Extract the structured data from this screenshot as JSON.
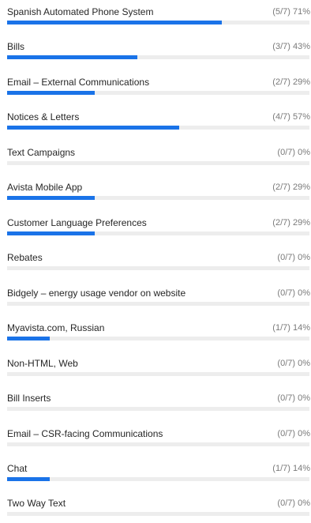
{
  "results": {
    "rows": [
      {
        "label": "Spanish Automated Phone System",
        "stat": "(5/7) 71%",
        "percent": 71
      },
      {
        "label": "Bills",
        "stat": "(3/7) 43%",
        "percent": 43
      },
      {
        "label": "Email – External Communications",
        "stat": "(2/7) 29%",
        "percent": 29
      },
      {
        "label": "Notices & Letters",
        "stat": "(4/7) 57%",
        "percent": 57
      },
      {
        "label": "Text Campaigns",
        "stat": "(0/7) 0%",
        "percent": 0
      },
      {
        "label": "Avista Mobile App",
        "stat": "(2/7) 29%",
        "percent": 29
      },
      {
        "label": "Customer Language Preferences",
        "stat": "(2/7) 29%",
        "percent": 29
      },
      {
        "label": "Rebates",
        "stat": "(0/7) 0%",
        "percent": 0
      },
      {
        "label": "Bidgely – energy usage vendor on website",
        "stat": "(0/7) 0%",
        "percent": 0
      },
      {
        "label": "Myavista.com, Russian",
        "stat": "(1/7) 14%",
        "percent": 14
      },
      {
        "label": "Non-HTML, Web",
        "stat": "(0/7) 0%",
        "percent": 0
      },
      {
        "label": "Bill Inserts",
        "stat": "(0/7) 0%",
        "percent": 0
      },
      {
        "label": "Email – CSR-facing Communications",
        "stat": "(0/7) 0%",
        "percent": 0
      },
      {
        "label": "Chat",
        "stat": "(1/7) 14%",
        "percent": 14
      },
      {
        "label": "Two Way Text",
        "stat": "(0/7) 0%",
        "percent": 0
      }
    ]
  },
  "colors": {
    "bar_fill": "#1a73e8",
    "bar_track": "#ededed"
  }
}
